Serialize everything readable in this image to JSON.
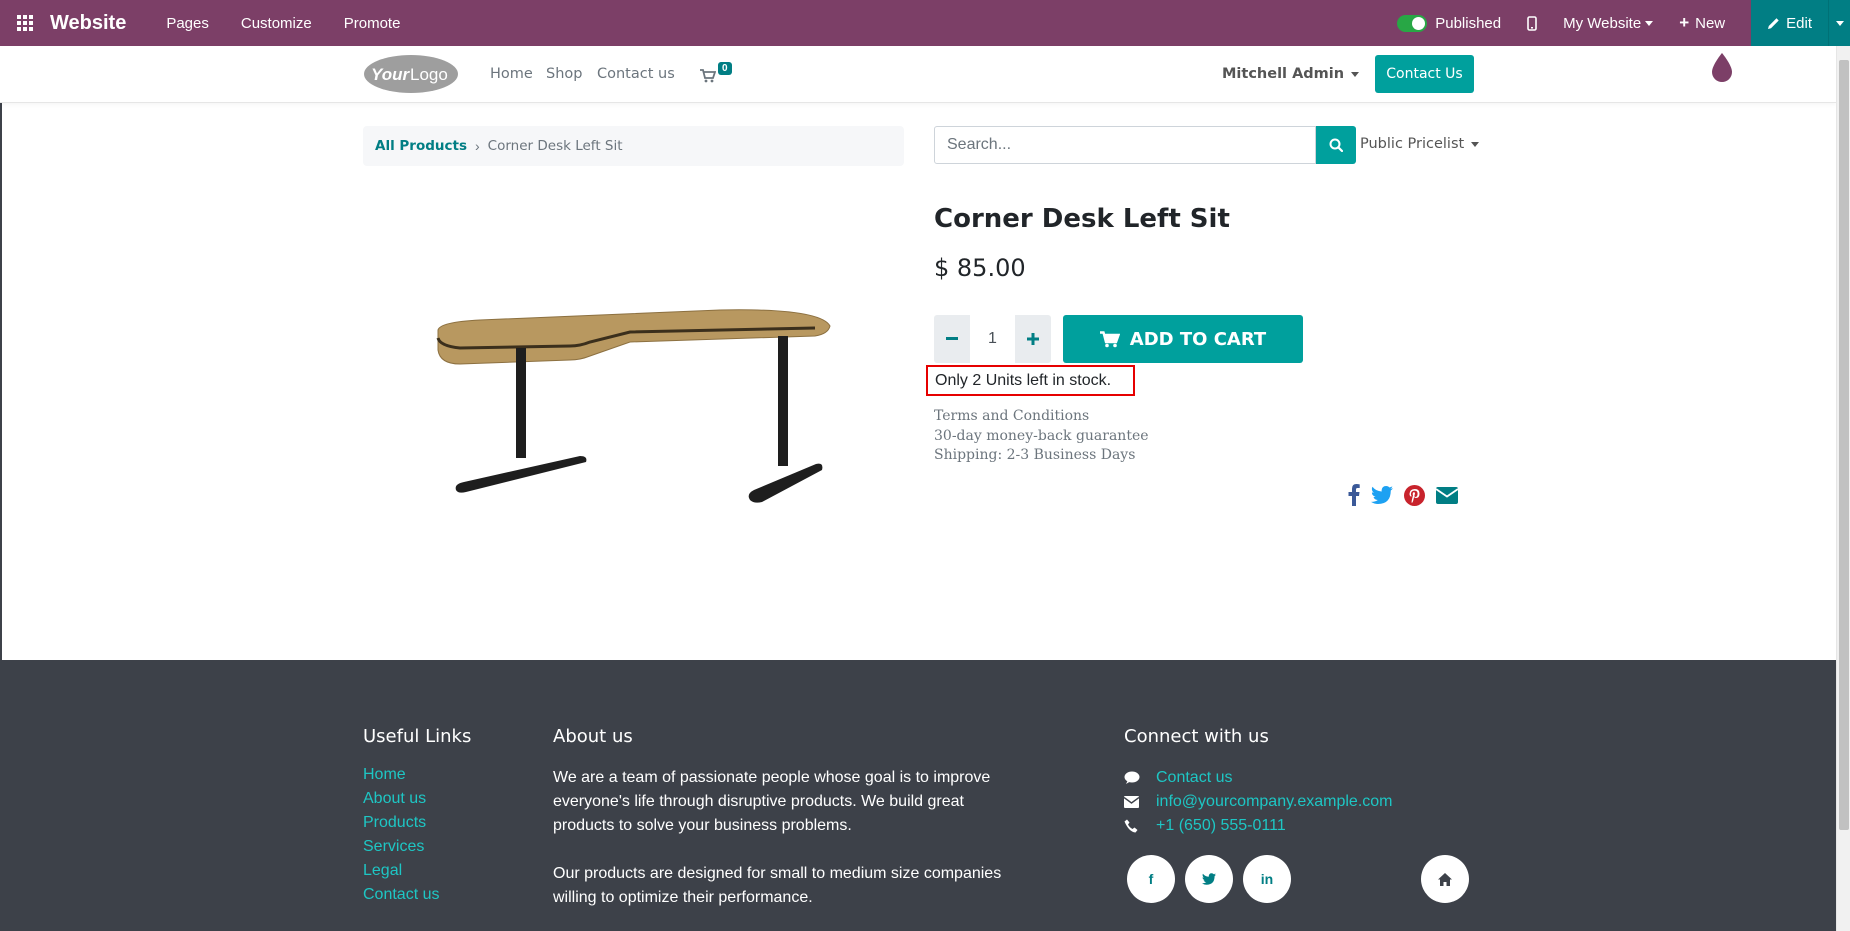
{
  "admin_bar": {
    "brand": "Website",
    "menu": [
      "Pages",
      "Customize",
      "Promote"
    ],
    "published_label": "Published",
    "website_label": "My Website",
    "new_label": "New",
    "edit_label": "Edit"
  },
  "header": {
    "logo_text": "YourLogo",
    "nav": [
      "Home",
      "Shop",
      "Contact us"
    ],
    "cart_count": "0",
    "user": "Mitchell Admin",
    "contact_button": "Contact Us"
  },
  "breadcrumb": {
    "parent": "All Products",
    "current": "Corner Desk Left Sit"
  },
  "search": {
    "placeholder": "Search..."
  },
  "pricelist": "Public Pricelist",
  "product": {
    "title": "Corner Desk Left Sit",
    "price": "$ 85.00",
    "quantity": "1",
    "add_to_cart": "ADD TO CART",
    "stock_message": "Only 2 Units left in stock.",
    "terms": [
      "Terms and Conditions",
      "30-day money-back guarantee",
      "Shipping: 2-3 Business Days"
    ]
  },
  "footer": {
    "useful_links_title": "Useful Links",
    "useful_links": [
      "Home",
      "About us",
      "Products",
      "Services",
      "Legal",
      "Contact us"
    ],
    "about_title": "About us",
    "about_p1": "We are a team of passionate people whose goal is to improve everyone's life through disruptive products. We build great products to solve your business problems.",
    "about_p2": "Our products are designed for small to medium size companies willing to optimize their performance.",
    "connect_title": "Connect with us",
    "contact_link": "Contact us",
    "email": "info@yourcompany.example.com",
    "phone": "+1 (650) 555-0111",
    "social": [
      "f",
      "in"
    ]
  },
  "colors": {
    "admin_bar": "#7c3f67",
    "accent": "#00a09d",
    "footer_bg": "#3d4149",
    "footer_link": "#1ec6c4",
    "stock_highlight": "#e60000"
  }
}
